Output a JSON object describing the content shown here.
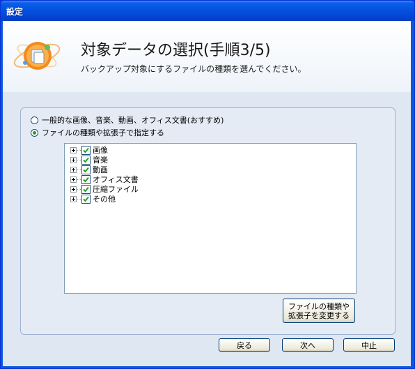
{
  "window": {
    "title": "設定"
  },
  "header": {
    "title": "対象データの選択(手順3/5)",
    "subtitle": "バックアップ対象にするファイルの種類を選んでください。"
  },
  "options": {
    "general": {
      "label": "一般的な画像、音楽、動画、オフィス文書(おすすめ)",
      "selected": false
    },
    "by_type": {
      "label": "ファイルの種類や拡張子で指定する",
      "selected": true
    }
  },
  "tree": {
    "items": [
      {
        "label": "画像",
        "checked": true
      },
      {
        "label": "音楽",
        "checked": true
      },
      {
        "label": "動画",
        "checked": true
      },
      {
        "label": "オフィス文書",
        "checked": true
      },
      {
        "label": "圧縮ファイル",
        "checked": true
      },
      {
        "label": "その他",
        "checked": true
      }
    ]
  },
  "buttons": {
    "change_types_line1": "ファイルの種類や",
    "change_types_line2": "拡張子を変更する",
    "back": "戻る",
    "next": "次へ",
    "cancel": "中止"
  },
  "colors": {
    "titlebar": "#0553e0",
    "client": "#dfe7f2",
    "check": "#21a121"
  }
}
